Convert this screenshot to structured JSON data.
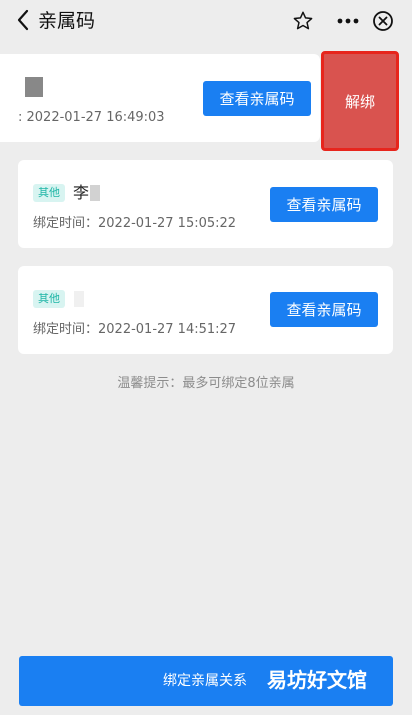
{
  "nav": {
    "title": "亲属码"
  },
  "cards": [
    {
      "name": "",
      "time": ": 2022-01-27 16:49:03",
      "view_label": "查看亲属码",
      "unbind_label": "解绑"
    },
    {
      "tag": "其他",
      "name": "李",
      "time": "绑定时间：2022-01-27 15:05:22",
      "view_label": "查看亲属码"
    },
    {
      "tag": "其他",
      "name": "",
      "time": "绑定时间：2022-01-27 14:51:27",
      "view_label": "查看亲属码"
    }
  ],
  "hint": "温馨提示：最多可绑定8位亲属",
  "bottom": {
    "label": "绑定亲属关系",
    "watermark": "易坊好文馆"
  },
  "colors": {
    "primary": "#1a7ff2",
    "danger": "#d9534f",
    "tag_text": "#1fb6a6",
    "background": "#ededed"
  },
  "icons": [
    "chevron-left-icon",
    "star-icon",
    "more-icon",
    "close-circle-icon"
  ]
}
